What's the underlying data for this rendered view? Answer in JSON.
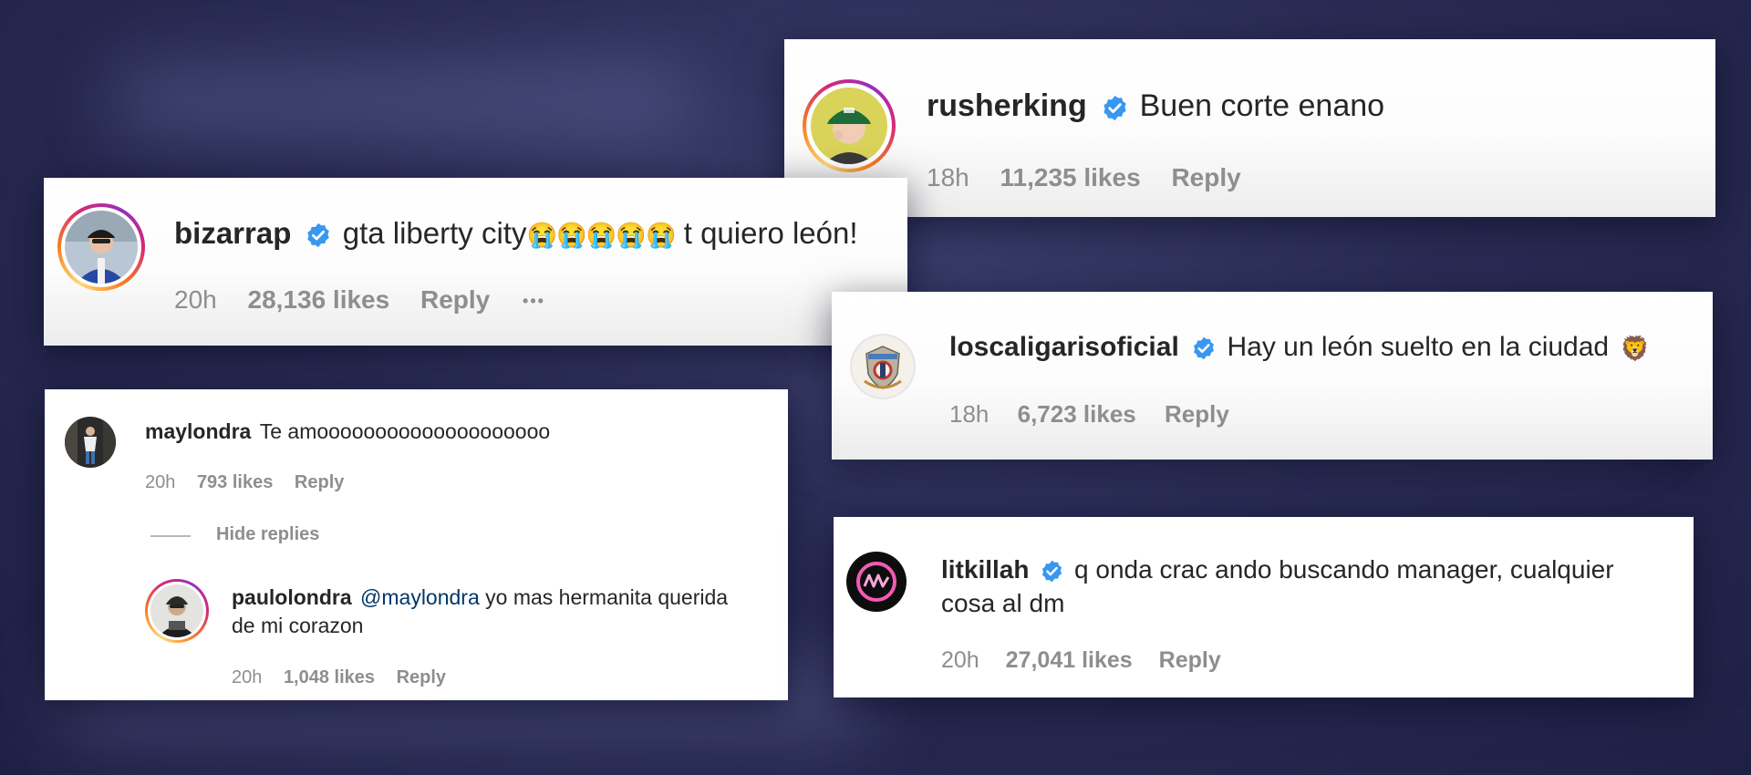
{
  "comments": {
    "rusherking": {
      "username": "rusherking",
      "text": "Buen corte enano",
      "time": "18h",
      "likes": "11,235 likes",
      "reply": "Reply",
      "verified": true
    },
    "bizarrap": {
      "username": "bizarrap",
      "text_before": "gta liberty city",
      "emoji": "😭😭😭😭😭",
      "text_after": " t quiero león!",
      "time": "20h",
      "likes": "28,136 likes",
      "reply": "Reply",
      "more": "•••",
      "verified": true
    },
    "loscaligarisoficial": {
      "username": "loscaligarisoficial",
      "text": "Hay un león suelto en la ciudad",
      "emoji": "🦁",
      "time": "18h",
      "likes": "6,723 likes",
      "reply": "Reply",
      "verified": true
    },
    "maylondra": {
      "username": "maylondra",
      "text": "Te amoooooooooooooooooooo",
      "time": "20h",
      "likes": "793 likes",
      "reply": "Reply",
      "hide_replies": "Hide replies",
      "reply_comment": {
        "username": "paulolondra",
        "mention": "@maylondra",
        "text_line1": " yo mas hermanita querida",
        "text_line2": "de mi corazon",
        "time": "20h",
        "likes": "1,048 likes",
        "reply": "Reply"
      }
    },
    "litkillah": {
      "username": "litkillah",
      "text_line1": "q onda crac ando buscando manager, cualquier",
      "text_line2": "cosa al dm",
      "time": "20h",
      "likes": "27,041 likes",
      "reply": "Reply",
      "verified": true
    }
  },
  "colors": {
    "background": "#2a2c55",
    "username": "#262626",
    "meta": "#8e8e8e",
    "verified": "#3897f0",
    "mention": "#00376b"
  }
}
